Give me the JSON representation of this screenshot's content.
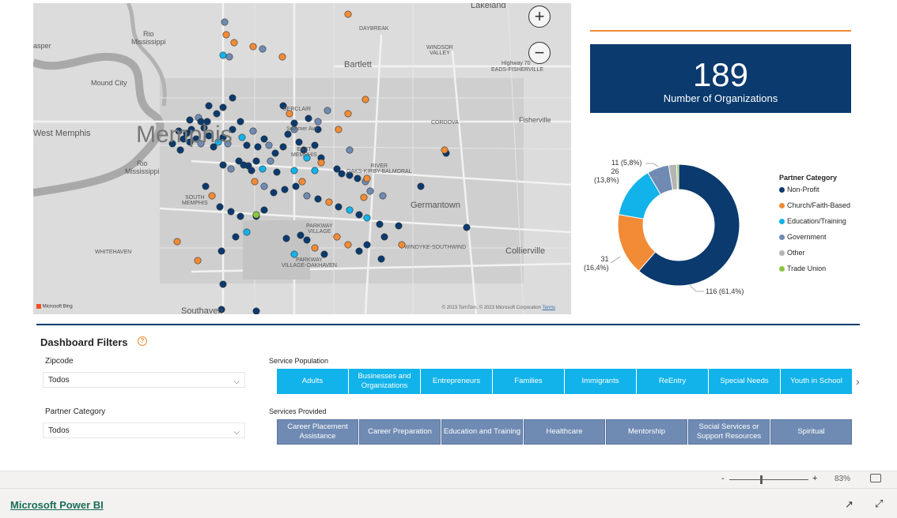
{
  "map": {
    "zoom_in": "+",
    "zoom_out": "−",
    "labels": {
      "lakeland": "Lakeland",
      "rio_mississippi_top": "Rio\nMississippi",
      "asper": "asper",
      "mound_city": "Mound City",
      "west_memphis": "West Memphis",
      "memphis": "Memphis",
      "rio_mississippi_bottom": "Rio\nMississippi",
      "bartlett": "Bartlett",
      "daybreak": "DAYBREAK",
      "windsor_valley": "WINDSOR\nVALLEY",
      "highway_70": "Highway 70",
      "eads_fisherville": "EADS-FISHERVILLE",
      "berclair": "BERCLAIR",
      "summer_ave": "Summer Ave",
      "cordova": "CORDOVA",
      "fisherville": "Fisherville",
      "east_memphis": "EAST\nMEMPHIS",
      "river_oaks": "RIVER\nOAKS-KIRBY-BALMORAL",
      "south_memphis": "SOUTH\nMEMPHIS",
      "germantown": "Germantown",
      "parkway_village": "PARKWAY\nVILLAGE",
      "parkway_village_oakhaven": "PARKWAY\nVILLAGE-OAKHAVEN",
      "windyke_southwind": "WINDYKE-SOUTHWIND",
      "collierville": "Collierville",
      "whitehaven": "WHITEHAVEN",
      "southaven": "Southaven"
    },
    "bing": "Microsoft Bing",
    "copyright": "© 2023 TomTom, © 2023 Microsoft Corporation",
    "terms": "Terms"
  },
  "kpi": {
    "value": "189",
    "label": "Number of Organizations",
    "accent": "#f18b36",
    "background": "#0a3a6e"
  },
  "chart_data": {
    "type": "pie",
    "variant": "donut",
    "legend_title": "Partner Category",
    "legend_position": "right",
    "categories": [
      "Non-Profit",
      "Church/Faith-Based",
      "Education/Training",
      "Government",
      "Other",
      "Trade Union"
    ],
    "values": [
      116,
      31,
      26,
      11,
      4,
      1
    ],
    "colors": [
      "#0a3a6e",
      "#f18b36",
      "#11b3ea",
      "#6f8bb3",
      "#b4b4b4",
      "#8cc63f"
    ],
    "data_labels": [
      "116 (61,4%)",
      "31\n(16,4%)",
      "26\n(13,8%)",
      "11 (5,8%)"
    ]
  },
  "filters": {
    "title": "Dashboard Filters",
    "help_icon": "?",
    "zipcode": {
      "label": "Zipcode",
      "value": "Todos"
    },
    "partner_category": {
      "label": "Partner Category",
      "value": "Todos"
    },
    "service_population": {
      "label": "Service Population",
      "options": [
        "Adults",
        "Businesses and Organizations",
        "Entrepreneurs",
        "Families",
        "Immigrants",
        "ReEntry",
        "Special Needs",
        "Youth in School"
      ]
    },
    "services_provided": {
      "label": "Services Provided",
      "options": [
        "Career Placement Assistance",
        "Career Preparation",
        "Education and Training",
        "Healthcare",
        "Mentorship",
        "Social Services or Support Resources",
        "Spiritual"
      ]
    }
  },
  "zoom": {
    "minus": "-",
    "plus": "+",
    "level": "83%",
    "level_fraction": 0.4
  },
  "footer": {
    "link": "Microsoft Power BI"
  }
}
